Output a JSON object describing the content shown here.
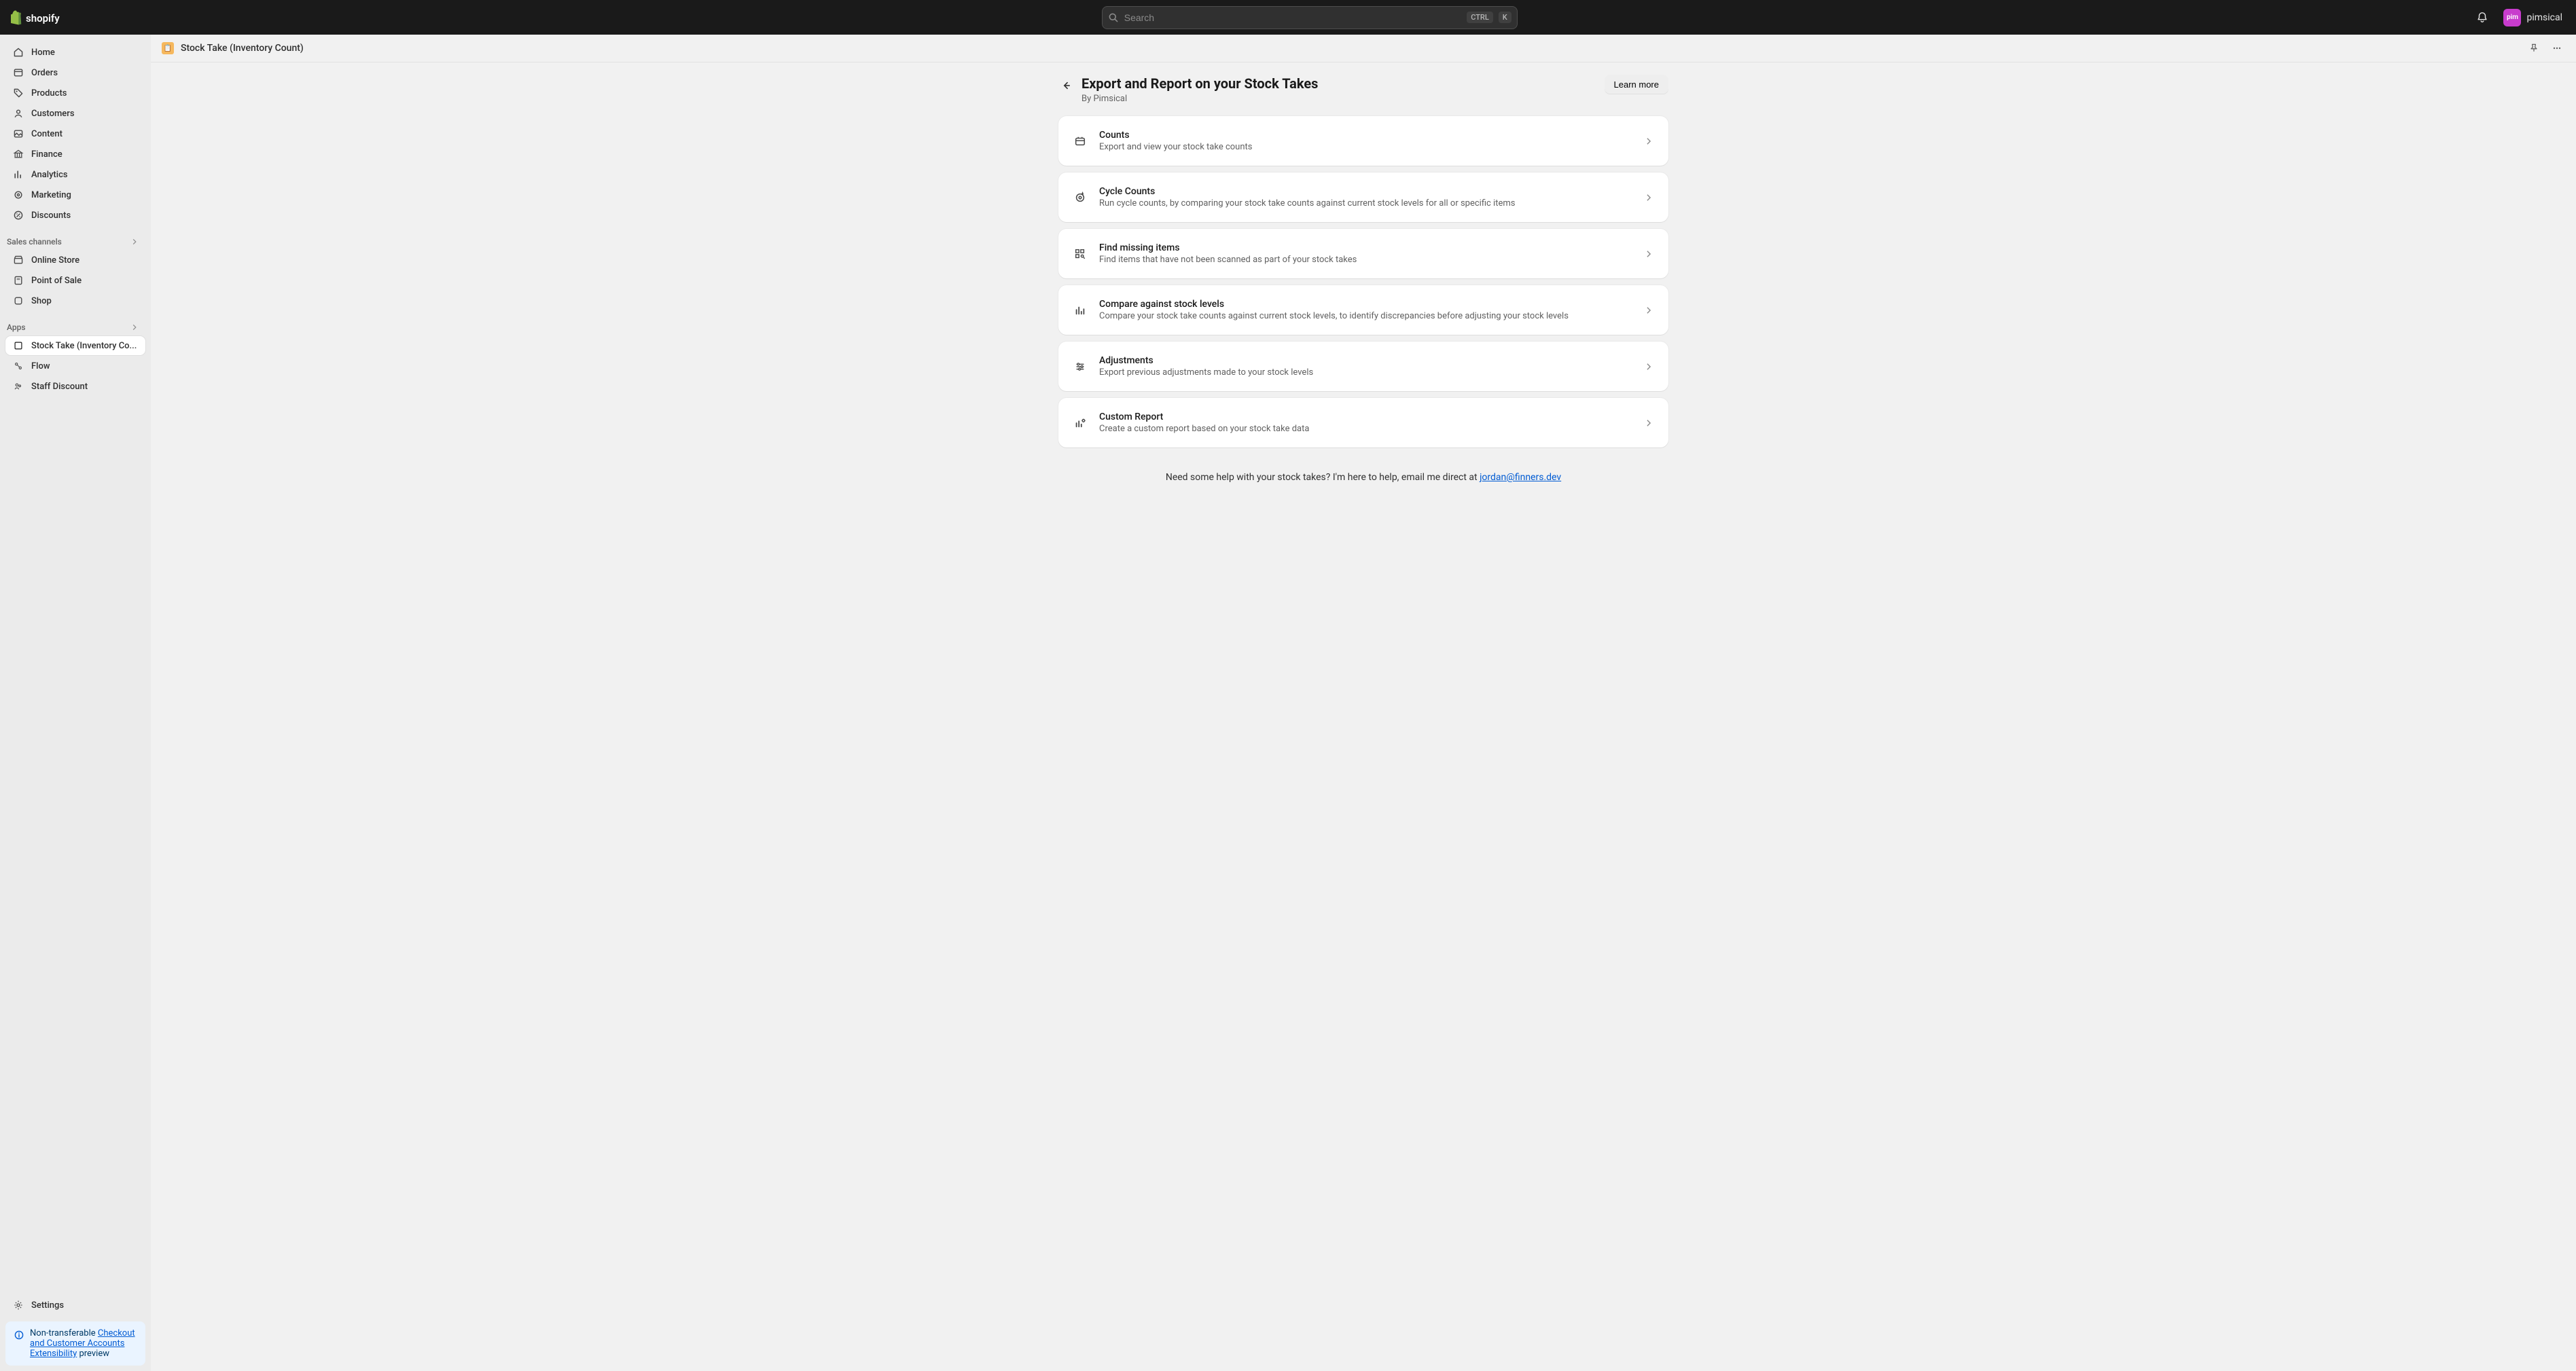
{
  "topbar": {
    "search_placeholder": "Search",
    "kbd_ctrl": "CTRL",
    "kbd_k": "K",
    "avatar_initials": "pim",
    "store_name": "pimsical"
  },
  "sidebar": {
    "items": [
      {
        "label": "Home"
      },
      {
        "label": "Orders"
      },
      {
        "label": "Products"
      },
      {
        "label": "Customers"
      },
      {
        "label": "Content"
      },
      {
        "label": "Finance"
      },
      {
        "label": "Analytics"
      },
      {
        "label": "Marketing"
      },
      {
        "label": "Discounts"
      }
    ],
    "sales_channels_label": "Sales channels",
    "channels": [
      {
        "label": "Online Store"
      },
      {
        "label": "Point of Sale"
      },
      {
        "label": "Shop"
      }
    ],
    "apps_label": "Apps",
    "apps": [
      {
        "label": "Stock Take (Inventory Co..."
      },
      {
        "label": "Flow"
      },
      {
        "label": "Staff Discount"
      }
    ],
    "settings_label": "Settings",
    "promo_prefix": "Non-transferable ",
    "promo_link": "Checkout and Customer Accounts Extensibility",
    "promo_suffix": " preview"
  },
  "app_bar": {
    "title": "Stock Take (Inventory Count)"
  },
  "page": {
    "title": "Export and Report on your Stock Takes",
    "byline": "By Pimsical",
    "learn_more": "Learn more"
  },
  "rows": [
    {
      "title": "Counts",
      "desc": "Export and view your stock take counts"
    },
    {
      "title": "Cycle Counts",
      "desc": "Run cycle counts, by comparing your stock take counts against current stock levels for all or specific items"
    },
    {
      "title": "Find missing items",
      "desc": "Find items that have not been scanned as part of your stock takes"
    },
    {
      "title": "Compare against stock levels",
      "desc": "Compare your stock take counts against current stock levels, to identify discrepancies before adjusting your stock levels"
    },
    {
      "title": "Adjustments",
      "desc": "Export previous adjustments made to your stock levels"
    },
    {
      "title": "Custom Report",
      "desc": "Create a custom report based on your stock take data"
    }
  ],
  "help": {
    "prefix": "Need some help with your stock takes? I'm here to help, email me direct at ",
    "email": "jordan@finners.dev"
  }
}
